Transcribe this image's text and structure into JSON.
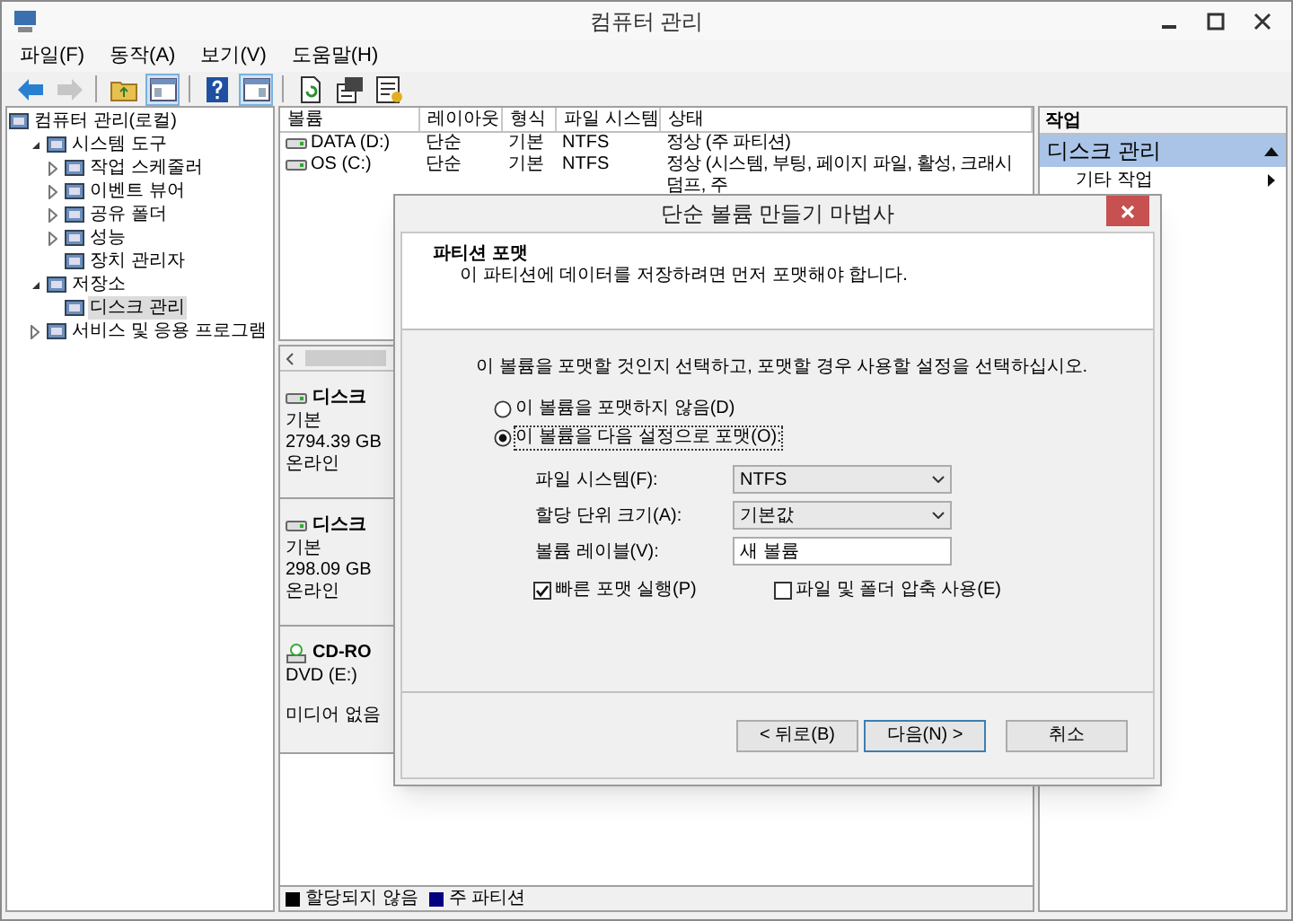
{
  "window": {
    "title": "컴퓨터 관리"
  },
  "menu": [
    "파일(F)",
    "동작(A)",
    "보기(V)",
    "도움말(H)"
  ],
  "toolbar": [
    [
      {
        "kind": "back",
        "disabled": false,
        "pressed": false
      },
      {
        "kind": "forward",
        "disabled": true,
        "pressed": false
      }
    ],
    [
      {
        "kind": "up",
        "disabled": false,
        "pressed": false
      },
      {
        "kind": "console_tree",
        "disabled": false,
        "pressed": true
      }
    ],
    [
      {
        "kind": "help",
        "disabled": false,
        "pressed": false
      },
      {
        "kind": "action_pane",
        "disabled": false,
        "pressed": true
      }
    ],
    [
      {
        "kind": "refresh",
        "disabled": false,
        "pressed": false
      },
      {
        "kind": "properties",
        "disabled": false,
        "pressed": false
      },
      {
        "kind": "export",
        "disabled": false,
        "pressed": false
      }
    ]
  ],
  "tree": [
    {
      "label": "컴퓨터 관리(로컬)",
      "kind": "root",
      "selected": false,
      "children": [
        {
          "label": "시스템 도구",
          "kind": "branch",
          "expanded": true,
          "selected": false,
          "children": [
            {
              "label": "작업 스케줄러",
              "kind": "branch",
              "expanded": false,
              "selected": false
            },
            {
              "label": "이벤트 뷰어",
              "kind": "branch",
              "expanded": false,
              "selected": false
            },
            {
              "label": "공유 폴더",
              "kind": "branch",
              "expanded": false,
              "selected": false
            },
            {
              "label": "성능",
              "kind": "branch",
              "expanded": false,
              "selected": false
            },
            {
              "label": "장치 관리자",
              "kind": "leaf",
              "selected": false
            }
          ]
        },
        {
          "label": "저장소",
          "kind": "branch",
          "expanded": true,
          "selected": false,
          "children": [
            {
              "label": "디스크 관리",
              "kind": "leaf",
              "selected": true
            }
          ]
        },
        {
          "label": "서비스 및 응용 프로그램",
          "kind": "branch",
          "expanded": false,
          "selected": false
        }
      ]
    }
  ],
  "volumes": {
    "columns": [
      "볼륨",
      "레이아웃",
      "형식",
      "파일 시스템",
      "상태"
    ],
    "rows": [
      [
        "DATA (D:)",
        "단순",
        "기본",
        "NTFS",
        "정상 (주 파티션)"
      ],
      [
        "OS (C:)",
        "단순",
        "기본",
        "NTFS",
        "정상 (시스템, 부팅, 페이지 파일, 활성, 크래시 덤프, 주"
      ]
    ]
  },
  "disks": [
    {
      "kind": "disk",
      "title": "디스크",
      "lines": [
        "기본",
        "2794.39 GB",
        "온라인"
      ]
    },
    {
      "kind": "disk",
      "title": "디스크",
      "lines": [
        "기본",
        "298.09 GB",
        "온라인"
      ]
    },
    {
      "kind": "cdrom",
      "title": "CD-RO",
      "lines": [
        "DVD (E:)",
        "미디어 없음"
      ]
    }
  ],
  "legend": [
    {
      "label": "할당되지 않음",
      "color": "#000000"
    },
    {
      "label": "주 파티션",
      "color": "#000080"
    }
  ],
  "actions": {
    "header": "작업",
    "sections": [
      {
        "title": "디스크 관리",
        "expanded": true,
        "items": [
          "기타 작업"
        ]
      }
    ]
  },
  "dialog": {
    "title": "단순 볼륨 만들기 마법사",
    "heading": "파티션 포맷",
    "subheading": "이 파티션에 데이터를 저장하려면 먼저 포맷해야 합니다.",
    "instruction": "이 볼륨을 포맷할 것인지 선택하고, 포맷할 경우 사용할 설정을 선택하십시오.",
    "options": [
      {
        "label": "이 볼륨을 포맷하지 않음(D)",
        "selected": false
      },
      {
        "label": "이 볼륨을 다음 설정으로 포맷(O):",
        "selected": true
      }
    ],
    "fields": [
      {
        "kind": "dropdown",
        "label": "파일 시스템(F):",
        "value": "NTFS"
      },
      {
        "kind": "dropdown",
        "label": "할당 단위 크기(A):",
        "value": "기본값"
      },
      {
        "kind": "text",
        "label": "볼륨 레이블(V):",
        "value": "새 볼륨"
      }
    ],
    "checkboxes": [
      {
        "label": "빠른 포맷 실행(P)",
        "checked": true
      },
      {
        "label": "파일 및 폴더 압축 사용(E)",
        "checked": false
      }
    ],
    "buttons": [
      {
        "label": "< 뒤로(B)",
        "default": false
      },
      {
        "label": "다음(N) >",
        "default": true
      },
      {
        "label": "취소",
        "default": false
      }
    ]
  }
}
